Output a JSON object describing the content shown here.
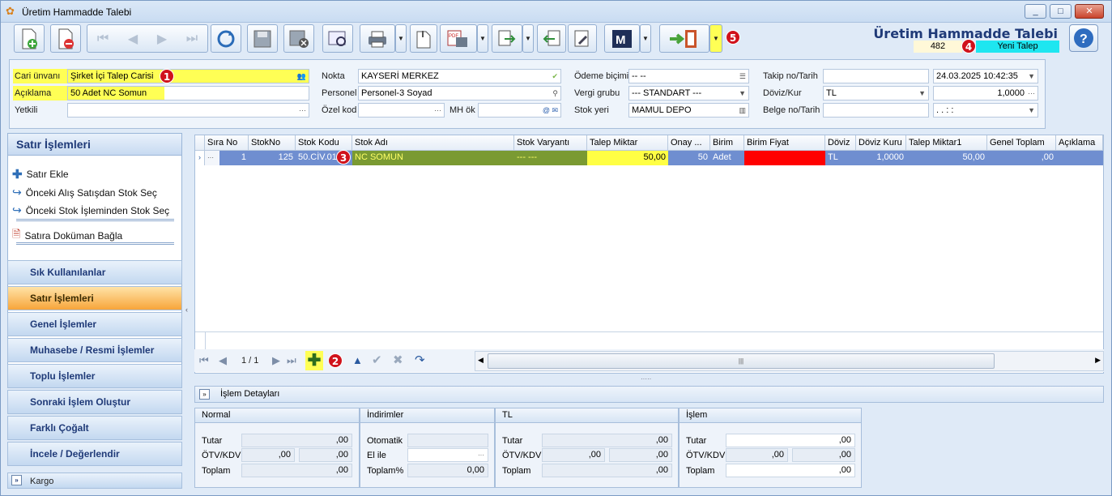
{
  "window": {
    "title": "Üretim Hammadde Talebi",
    "controls": [
      "_",
      "□",
      "✕"
    ]
  },
  "header": {
    "title": "Üretim Hammadde Talebi",
    "number": "482",
    "status": "Yeni Talep"
  },
  "badges": {
    "b1": "1",
    "b2": "2",
    "b3": "3",
    "b4": "4",
    "b5": "5"
  },
  "form": {
    "cari_label": "Cari ünvanı",
    "cari_value": "Şirket İçi Talep Carisi",
    "aciklama_label": "Açıklama",
    "aciklama_value": "50 Adet NC Somun",
    "yetkili_label": "Yetkili",
    "yetkili_value": "",
    "nokta_label": "Nokta",
    "nokta_value": "KAYSERİ MERKEZ",
    "personel_label": "Personel",
    "personel_value": "Personel-3 Soyad",
    "ozelkod_label": "Özel kod",
    "ozelkod_value": "",
    "mhok_label": "MH ök",
    "mhok_value": "",
    "odeme_label": "Ödeme biçimi",
    "odeme_value": "-- --",
    "vergi_label": "Vergi grubu",
    "vergi_value": "--- STANDART ---",
    "stokyeri_label": "Stok yeri",
    "stokyeri_value": "MAMUL DEPO",
    "takip_label": "Takip no/Tarih",
    "takip_value": "",
    "takip_date": "24.03.2025 10:42:35",
    "doviz_label": "Döviz/Kur",
    "doviz_value": "TL",
    "kur_value": "1,0000",
    "belge_label": "Belge no/Tarih",
    "belge_value": "",
    "belge_date": ".   .        :  :"
  },
  "left_panel": {
    "title": "Satır İşlemleri",
    "actions": [
      "Satır Ekle",
      "Önceki Alış Satışdan Stok Seç",
      "Önceki Stok İşleminden Stok Seç",
      "Satıra Doküman Bağla"
    ],
    "categories": [
      "Sık Kullanılanlar",
      "Satır İşlemleri",
      "Genel İşlemler",
      "Muhasebe / Resmi İşlemler",
      "Toplu İşlemler",
      "Sonraki İşlem Oluştur",
      "Farklı Çoğalt",
      "İncele / Değerlendir",
      "Kargo"
    ],
    "active_category": "Satır İşlemleri"
  },
  "grid": {
    "columns": [
      "Sıra No",
      "StokNo",
      "Stok Kodu",
      "Stok Adı",
      "Stok Varyantı",
      "Talep Miktar",
      "Onay ...",
      "Birim",
      "Birim Fiyat",
      "Döviz",
      "Döviz Kuru",
      "Talep Miktar1",
      "Genel Toplam",
      "Açıklama"
    ],
    "rows": [
      {
        "sira": "1",
        "stokno": "125",
        "stokkodu": "50.CİV.01",
        "stokadi": "NC SOMUN",
        "varyant": "--- ---",
        "talep": "50,00",
        "onay": "50",
        "birim": "Adet",
        "birimfiyat": "",
        "doviz": "TL",
        "kur": "1,0000",
        "talep1": "50,00",
        "genel": ",00",
        "aciklama": ""
      }
    ],
    "page": "1 / 1"
  },
  "details": {
    "bar_label": "İşlem Detayları",
    "normal": {
      "title": "Normal",
      "tutar_label": "Tutar",
      "tutar": ",00",
      "otv_label": "ÖTV/KDV",
      "otv": ",00",
      "kdv": ",00",
      "toplam_label": "Toplam",
      "toplam": ",00"
    },
    "indirimler": {
      "title": "İndirimler",
      "oto_label": "Otomatik",
      "oto": "",
      "elile_label": "El ile",
      "elile": "",
      "toplam_label": "Toplam%",
      "toplam": "0,00"
    },
    "tl": {
      "title": "TL",
      "tutar": ",00",
      "otv": ",00",
      "kdv": ",00",
      "toplam": ",00",
      "tutar_label": "Tutar",
      "otv_label": "ÖTV/KDV",
      "toplam_label": "Toplam"
    },
    "islem": {
      "title": "İşlem",
      "tutar": ",00",
      "otv": ",00",
      "kdv": ",00",
      "toplam": ",00",
      "tutar_label": "Tutar",
      "otv_label": "ÖTV/KDV",
      "toplam_label": "Toplam"
    }
  },
  "colors": {
    "highlight_yellow": "#ffff55",
    "status_cyan": "#1ee6f0",
    "row_blue": "#6f8ed0",
    "cell_red": "#ff0000",
    "cell_olive": "#7a9a32",
    "badge_red": "#d0121b"
  }
}
